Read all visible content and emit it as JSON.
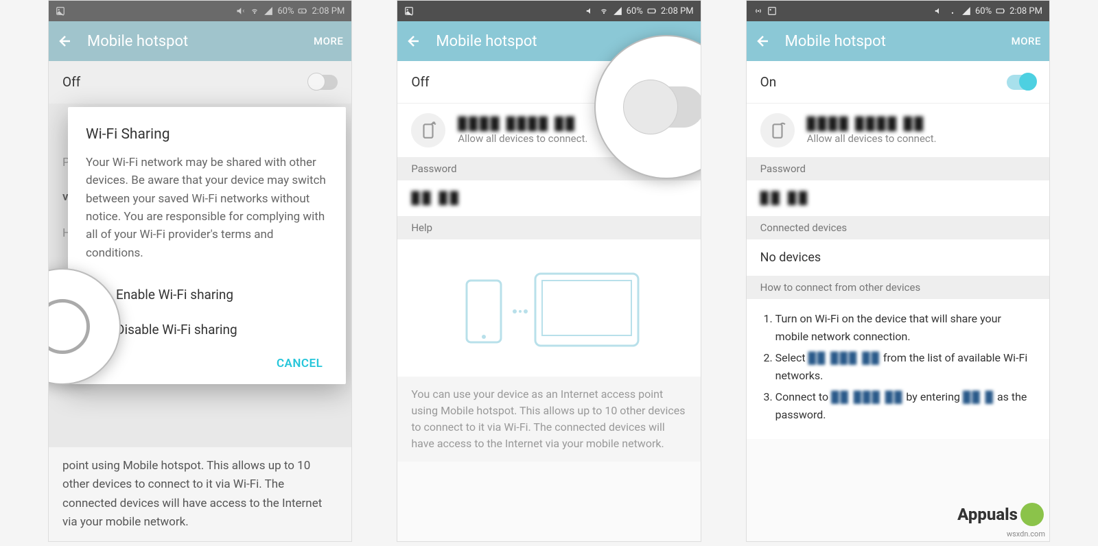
{
  "status_bar": {
    "battery": "60%",
    "time": "2:08 PM"
  },
  "app_bar": {
    "title": "Mobile hotspot",
    "more": "MORE"
  },
  "screen1": {
    "toggle_state": "Off",
    "dialog": {
      "title": "Wi-Fi Sharing",
      "body": "Your Wi-Fi network may be shared with other devices. Be aware that your device may switch between your saved Wi-Fi networks without notice. You are responsible for complying with all of your Wi-Fi provider's terms and conditions.",
      "option_enable": "Enable Wi-Fi sharing",
      "option_disable": "Disable Wi-Fi sharing",
      "cancel": "CANCEL"
    },
    "bg_pa": "Pa",
    "bg_vx": "vx",
    "bg_he": "He",
    "help_text": "point using Mobile hotspot. This allows up to 10 other devices to connect to it via Wi-Fi. The connected devices will have access to the Internet via your mobile network."
  },
  "screen2": {
    "toggle_state": "Off",
    "hotspot_sub": "Allow all devices to connect.",
    "password_header": "Password",
    "help_header": "Help",
    "help_text": "You can use your device as an Internet access point using Mobile hotspot. This allows up to 10 other devices to connect to it via Wi-Fi. The connected devices will have access to the Internet via your mobile network."
  },
  "screen3": {
    "toggle_state": "On",
    "hotspot_sub": "Allow all devices to connect.",
    "password_header": "Password",
    "connected_header": "Connected devices",
    "no_devices": "No devices",
    "how_to_header": "How to connect from other devices",
    "step1": "Turn on Wi-Fi on the device that will share your mobile network connection.",
    "step2_a": "Select ",
    "step2_b": " from the list of available Wi-Fi networks.",
    "step3_a": "Connect to ",
    "step3_b": " by entering ",
    "step3_c": " as the password."
  },
  "watermark": "wsxdn.com",
  "appuals": "Appuals"
}
